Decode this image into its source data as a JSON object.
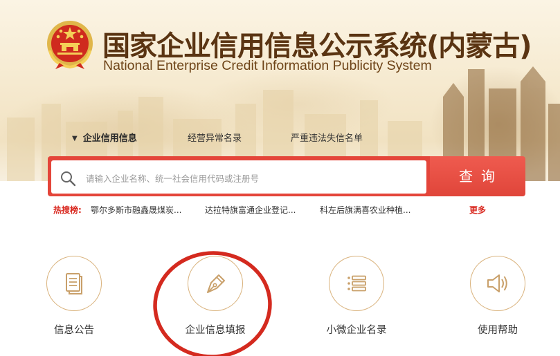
{
  "header": {
    "title_cn": "国家企业信用信息公示系统(内蒙古)",
    "title_en": "National Enterprise Credit Information Publicity System"
  },
  "tabs": [
    {
      "label": "企业信用信息",
      "active": true
    },
    {
      "label": "经营异常名录",
      "active": false
    },
    {
      "label": "严重违法失信名单",
      "active": false
    }
  ],
  "search": {
    "placeholder": "请输入企业名称、统一社会信用代码或注册号",
    "value": "",
    "button_label": "查询"
  },
  "hot_search": {
    "label": "热搜榜:",
    "items": [
      "鄂尔多斯市融鑫晟煤炭...",
      "达拉特旗富通企业登记...",
      "科左后旗满喜农业种植..."
    ],
    "more_label": "更多"
  },
  "services": [
    {
      "label": "信息公告",
      "icon": "document-icon"
    },
    {
      "label": "企业信息填报",
      "icon": "pen-nib-icon"
    },
    {
      "label": "小微企业名录",
      "icon": "list-icon"
    },
    {
      "label": "使用帮助",
      "icon": "speaker-icon"
    }
  ],
  "colors": {
    "brand_red": "#e4453a",
    "gold": "#d9b27c",
    "title_brown": "#5a3412",
    "annotation_red": "#d42a1f"
  }
}
